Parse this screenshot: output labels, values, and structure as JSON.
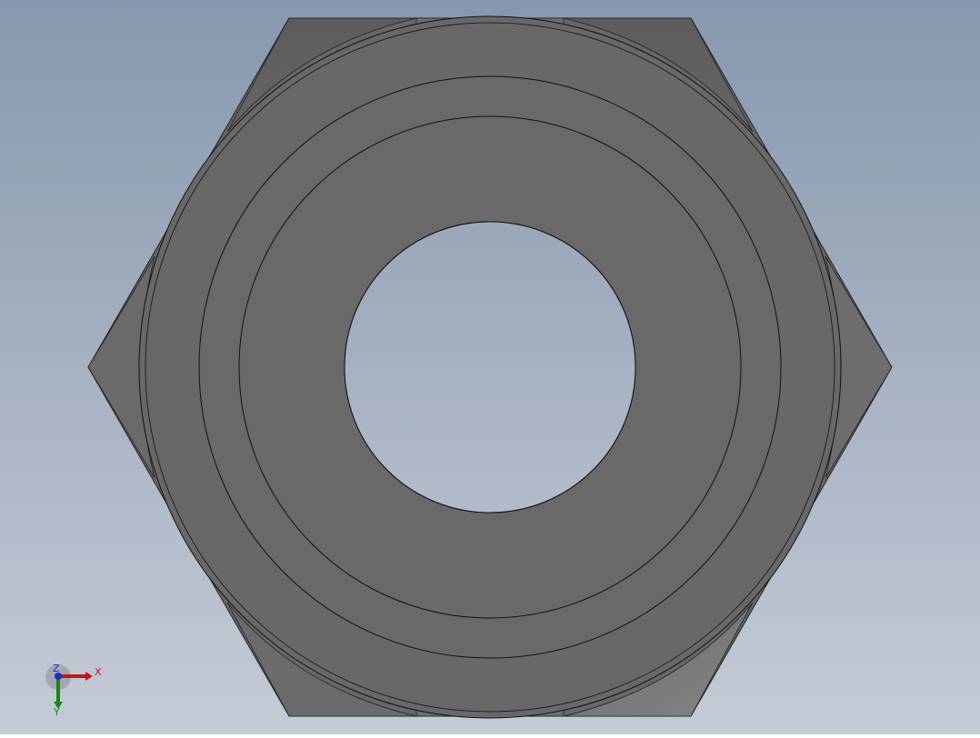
{
  "view": {
    "background_top": "#8798ad",
    "background_bottom": "#c5cbd6",
    "part": "hex-nut",
    "part_colors": {
      "face": "#696969",
      "chamfer_dark": "#5f5f5f",
      "chamfer_mid": "#6d6d6d",
      "chamfer_light": "#7b7b7b",
      "edge": "#111111"
    }
  },
  "triad": {
    "x_label": "X",
    "y_label": "Y",
    "z_label": "Z",
    "x_color": "#c0161d",
    "y_color": "#128a14",
    "z_color": "#1a2bd0"
  }
}
